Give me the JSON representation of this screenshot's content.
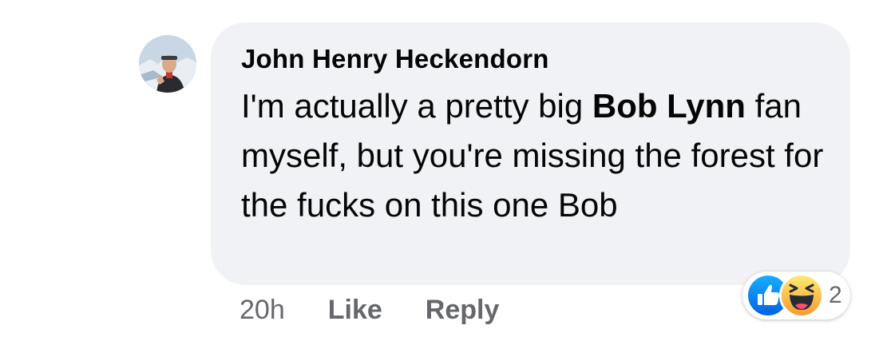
{
  "comment": {
    "author": "John Henry Heckendorn",
    "text_before": "I'm actually a pretty big ",
    "mention": "Bob Lynn",
    "text_after": " fan myself, but you're missing the forest for the fucks on this one Bob"
  },
  "meta": {
    "timestamp": "20h",
    "like_label": "Like",
    "reply_label": "Reply"
  },
  "reactions": {
    "icons": [
      "like-icon",
      "haha-icon"
    ],
    "count": "2",
    "colors": {
      "like": "#1877f2",
      "haha": "#f7b125"
    }
  },
  "colors": {
    "bubble": "#f0f2f5",
    "text": "#050505",
    "secondary": "#65676b"
  }
}
